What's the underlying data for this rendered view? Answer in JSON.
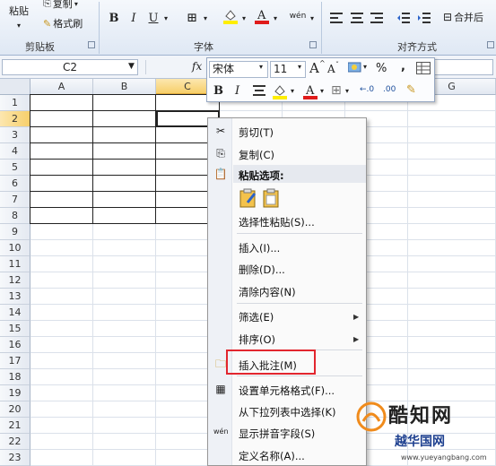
{
  "ribbon": {
    "paste": "粘贴",
    "copy": "复制",
    "format_painter": "格式刷",
    "clipboard_group": "剪贴板",
    "font_group": "字体",
    "align_group": "对齐方式",
    "bold": "B",
    "italic": "I",
    "underline": "U",
    "merge": "合并后"
  },
  "formula_bar": {
    "name_box": "C2",
    "fx": "fx"
  },
  "grid": {
    "columns": [
      "A",
      "B",
      "C",
      "",
      "",
      "",
      "G"
    ],
    "rows": [
      "1",
      "2",
      "3",
      "4",
      "5",
      "6",
      "7",
      "8",
      "9",
      "10",
      "11",
      "12",
      "13",
      "14",
      "15",
      "16",
      "17",
      "18",
      "19",
      "20",
      "21",
      "22",
      "23"
    ],
    "selected_column": "C",
    "selected_row": "2"
  },
  "mini_toolbar": {
    "font": "宋体",
    "size": "11",
    "grow": "A",
    "shrink": "A",
    "percent": "%",
    "comma": ",",
    "bold": "B",
    "italic": "I"
  },
  "context_menu": {
    "cut": "剪切(T)",
    "copy": "复制(C)",
    "paste_options": "粘贴选项:",
    "paste_special": "选择性粘贴(S)...",
    "insert": "插入(I)...",
    "delete": "删除(D)...",
    "clear": "清除内容(N)",
    "filter": "筛选(E)",
    "sort": "排序(O)",
    "insert_comment": "插入批注(M)",
    "format_cells": "设置单元格格式(F)...",
    "pick_list": "从下拉列表中选择(K)",
    "phonetic": "显示拼音字段(S)",
    "define_name": "定义名称(A)..."
  },
  "watermark": {
    "title": "酷知网",
    "sub": "越华国网",
    "url": "www.yueyangbang.com"
  },
  "colors": {
    "highlight": "#e2262e",
    "select": "#f7cf6a"
  }
}
